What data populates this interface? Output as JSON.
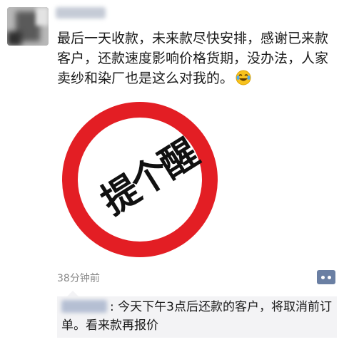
{
  "post": {
    "text": "最后一天收款，未来款尽快安排，感谢已来款客户，还款速度影响价格货期，没办法，人家卖纱和染厂也是这么对我的。",
    "emoji_icon": "crying-laughing-emoji",
    "image": {
      "sign_text_1": "提",
      "sign_text_2": "个",
      "sign_text_3": "醒",
      "ring_color": "#e31e24"
    },
    "timestamp": "38分钟前"
  },
  "comment_button": {
    "icon": "comment-dots-icon",
    "color": "#6a7fa3"
  },
  "comment": {
    "text": ": 今天下午3点后还款的客户，将取消前订单。看来款再报价"
  }
}
